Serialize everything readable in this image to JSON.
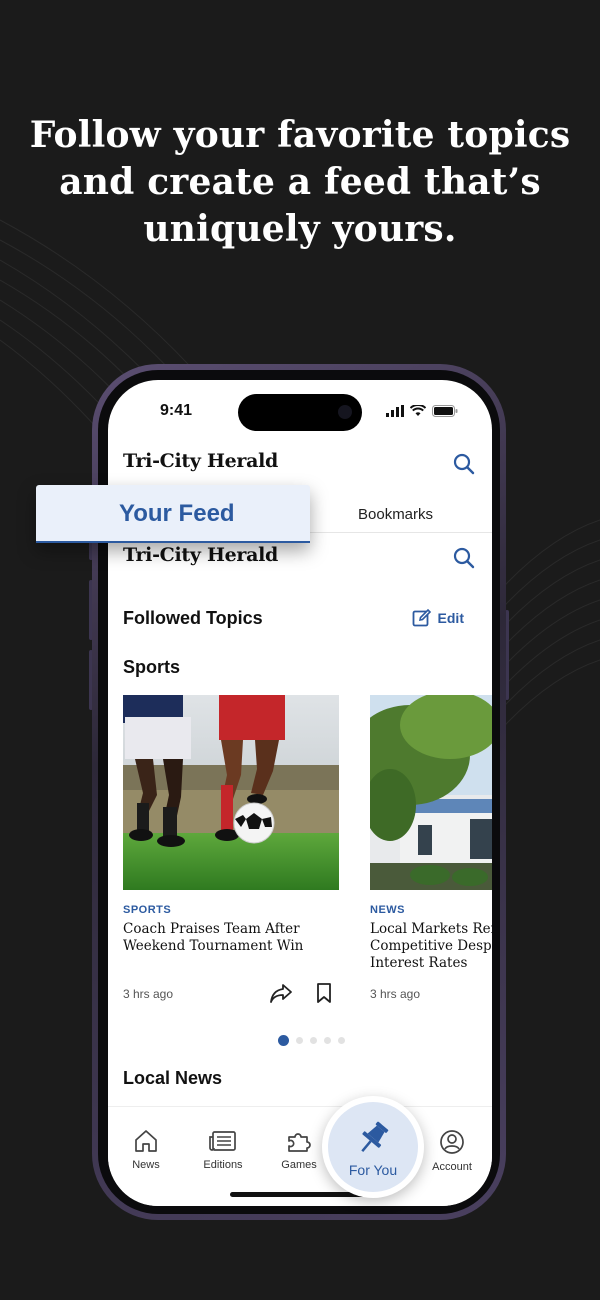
{
  "headline": {
    "line1": "Follow your favorite topics",
    "line2": "and create a feed that’s",
    "line3": "uniquely yours."
  },
  "status_bar": {
    "time": "9:41"
  },
  "app": {
    "logo": "Tri-City Herald"
  },
  "tabs": {
    "your_feed": "Your Feed",
    "bookmarks": "Bookmarks"
  },
  "followed": {
    "title": "Followed Topics",
    "edit_label": "Edit"
  },
  "sports_section": {
    "title": "Sports"
  },
  "cards": [
    {
      "category": "SPORTS",
      "title_line1": "Coach Praises Team After",
      "title_line2": "Weekend Tournament Win",
      "title_line3": "",
      "time": "3 hrs ago"
    },
    {
      "category": "NEWS",
      "title_line1": "Local Markets Rem",
      "title_line2": "Competitive Despit",
      "title_line3": "Interest Rates",
      "time": "3 hrs ago"
    }
  ],
  "carousel": {
    "current": 1,
    "total": 5
  },
  "local_section": {
    "title": "Local News"
  },
  "bottom_nav": {
    "news": "News",
    "editions": "Editions",
    "games": "Games",
    "for_you": "For You",
    "account": "Account"
  },
  "colors": {
    "accent": "#2c5aa0",
    "background": "#1b1b1b"
  }
}
